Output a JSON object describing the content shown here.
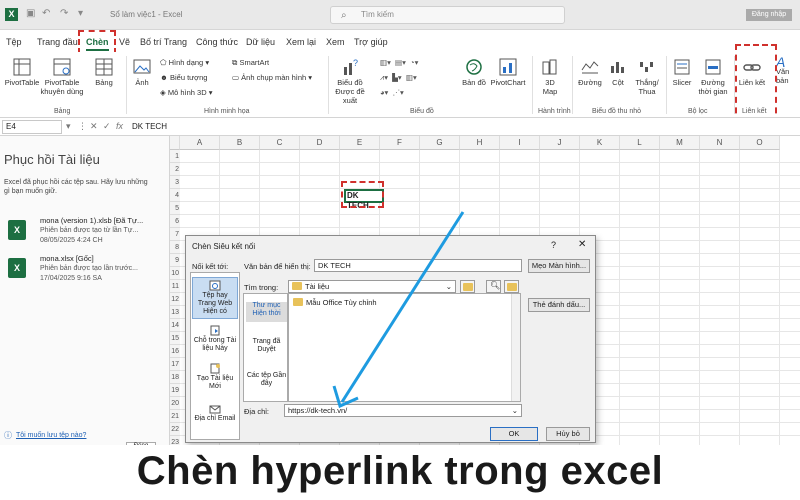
{
  "titlebar": {
    "doc_title": "Sổ làm việc1 - Excel",
    "search_placeholder": "Tìm kiếm",
    "signin": "Đăng nhập"
  },
  "tabs": [
    "Tệp",
    "Trang đầu",
    "Chèn",
    "Vẽ",
    "Bố trí Trang",
    "Công thức",
    "Dữ liệu",
    "Xem lại",
    "Xem",
    "Trợ giúp"
  ],
  "active_tab": "Chèn",
  "ribbon": {
    "pivottable": "PivotTable",
    "pivottable_rec": "PivotTable khuyên dùng",
    "table": "Bảng",
    "group_tables": "Bảng",
    "image": "Ảnh",
    "shapes": "Hình dạng",
    "icons": "Biểu tượng",
    "models3d": "Mô hình 3D",
    "smartart": "SmartArt",
    "screenshot": "Ảnh chụp màn hình",
    "group_illustrations": "Hình minh họa",
    "rec_charts": "Biểu đồ Được đề xuất",
    "maps": "Bản đồ",
    "pivotchart": "PivotChart",
    "group_charts": "Biểu đồ",
    "map3d": "3D Map",
    "group_tours": "Hành trình",
    "sp_line": "Đường",
    "sp_column": "Cột",
    "sp_winloss": "Thắng/ Thua",
    "group_sparklines": "Biểu đồ thu nhỏ",
    "slicer": "Slicer",
    "timeline": "Đường thời gian",
    "group_filters": "Bộ lọc",
    "link": "Liên kết",
    "group_links": "Liên kết",
    "text": "Văn bản"
  },
  "formula_bar": {
    "name_box": "E4",
    "value": "DK TECH"
  },
  "recovery": {
    "title": "Phục hồi Tài liệu",
    "description": "Excel đã phục hồi các tệp sau. Hãy lưu những gì bạn muốn giữ.",
    "files": [
      {
        "name": "mona (version 1).xlsb [Đã Tự...",
        "status": "Phiên bản được tạo từ lần Tự...",
        "time": "08/05/2025 4:24 CH"
      },
      {
        "name": "mona.xlsx [Gốc]",
        "status": "Phiên bản được tạo lần trước...",
        "time": "17/04/2025 9:16 SA"
      }
    ],
    "help_link": "Tôi muốn lưu tệp nào?",
    "close": "Đóng"
  },
  "grid": {
    "columns": [
      "A",
      "B",
      "C",
      "D",
      "E",
      "F",
      "G",
      "H",
      "I",
      "J",
      "K",
      "L",
      "M",
      "N",
      "O"
    ],
    "rows": [
      "1",
      "2",
      "3",
      "4",
      "5",
      "6",
      "7",
      "8",
      "9",
      "10",
      "11",
      "12",
      "13",
      "14",
      "15",
      "16",
      "17",
      "18",
      "19",
      "20",
      "21",
      "22",
      "23"
    ],
    "cell_E4": "DK TECH"
  },
  "dialog": {
    "title": "Chèn Siêu kết nối",
    "help": "?",
    "close": "✕",
    "link_to_label": "Nối kết tới:",
    "link_items": [
      "Tệp hay Trang Web Hiện có",
      "Chỗ trong Tài liệu Này",
      "Tạo Tài liệu Mới",
      "Địa chỉ Email"
    ],
    "display_text_label": "Văn bản để hiển thị:",
    "display_text_value": "DK TECH",
    "screentip": "Mẹo Màn hình...",
    "look_in_label": "Tìm trong:",
    "look_in_value": "Tài liệu",
    "browse_items": [
      "Thư mục Hiện thời",
      "Trang đã Duyệt",
      "Các tệp Gần đây"
    ],
    "file_item": "Mẫu Office Tùy chỉnh",
    "bookmark": "Thẻ đánh dấu...",
    "address_label": "Địa chỉ:",
    "address_value": "https://dk-tech.vn/",
    "ok": "OK",
    "cancel": "Hủy bỏ"
  },
  "caption": "Chèn hyperlink trong excel",
  "colors": {
    "excel_green": "#1d6f42",
    "highlight_red": "#d0312d",
    "arrow_blue": "#1e9be0"
  }
}
